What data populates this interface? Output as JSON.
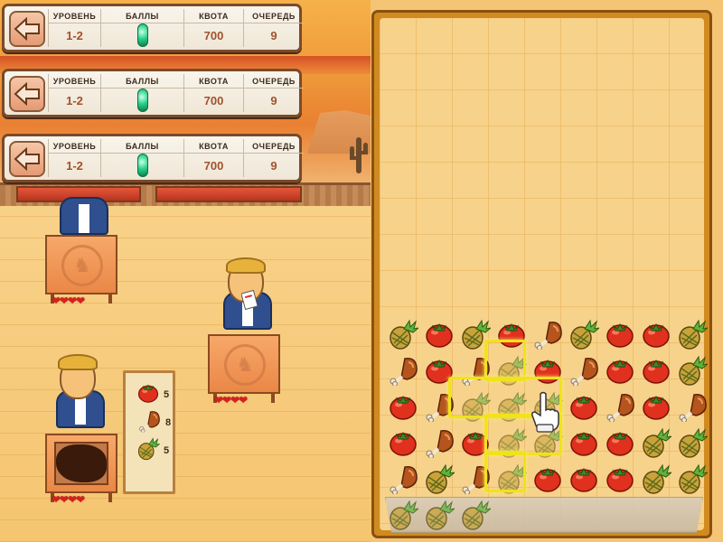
{
  "hud_panels": [
    {
      "level_label": "УРОВЕНЬ",
      "level_value": "1-2",
      "score_label": "БАЛЛЫ",
      "quota_label": "КВОТА",
      "quota_value": "700",
      "queue_label": "ОЧЕРЕДЬ",
      "queue_value": "9"
    },
    {
      "level_label": "УРОВЕНЬ",
      "level_value": "1-2",
      "score_label": "БАЛЛЫ",
      "quota_label": "КВОТА",
      "quota_value": "700",
      "queue_label": "ОЧЕРЕДЬ",
      "queue_value": "9"
    },
    {
      "level_label": "УРОВЕНЬ",
      "level_value": "1-2",
      "score_label": "БАЛЛЫ",
      "quota_label": "КВОТА",
      "quota_value": "700",
      "queue_label": "ОЧЕРЕДЬ",
      "queue_value": "9"
    }
  ],
  "customers": [
    {
      "hearts": 4,
      "crate": "emblem"
    },
    {
      "hearts": 4,
      "crate": "emblem"
    },
    {
      "hearts": 4,
      "crate": "dark"
    }
  ],
  "order": [
    {
      "item": "tomato",
      "count": "5"
    },
    {
      "item": "drumstick",
      "count": "8"
    },
    {
      "item": "pineapple",
      "count": "5"
    }
  ],
  "board": {
    "rows": [
      [
        "pineapple",
        "tomato",
        "pineapple",
        "tomato",
        "drumstick",
        "pineapple",
        "tomato",
        "tomato",
        "pineapple"
      ],
      [
        "drumstick",
        "tomato",
        "drumstick",
        "pineapple",
        "tomato",
        "drumstick",
        "tomato",
        "tomato",
        "pineapple"
      ],
      [
        "tomato",
        "drumstick",
        "pineapple",
        "pineapple",
        "pineapple",
        "tomato",
        "drumstick",
        "tomato",
        "drumstick"
      ],
      [
        "tomato",
        "drumstick",
        "tomato",
        "pineapple",
        "pineapple",
        "tomato",
        "tomato",
        "pineapple",
        "pineapple"
      ],
      [
        "drumstick",
        "pineapple",
        "drumstick",
        "pineapple",
        "tomato",
        "tomato",
        "tomato",
        "pineapple",
        "pineapple"
      ]
    ],
    "faded": [
      [
        1,
        3
      ],
      [
        2,
        2
      ],
      [
        2,
        3
      ],
      [
        2,
        4
      ],
      [
        3,
        3
      ],
      [
        3,
        4
      ],
      [
        4,
        3
      ]
    ],
    "tray": [
      "pineapple",
      "pineapple",
      "pineapple"
    ]
  },
  "colors": {
    "tomato": "#e0301e",
    "drumstick": "#b5541c",
    "pineapple": "#7aa63a",
    "highlight": "#f2e21a"
  }
}
